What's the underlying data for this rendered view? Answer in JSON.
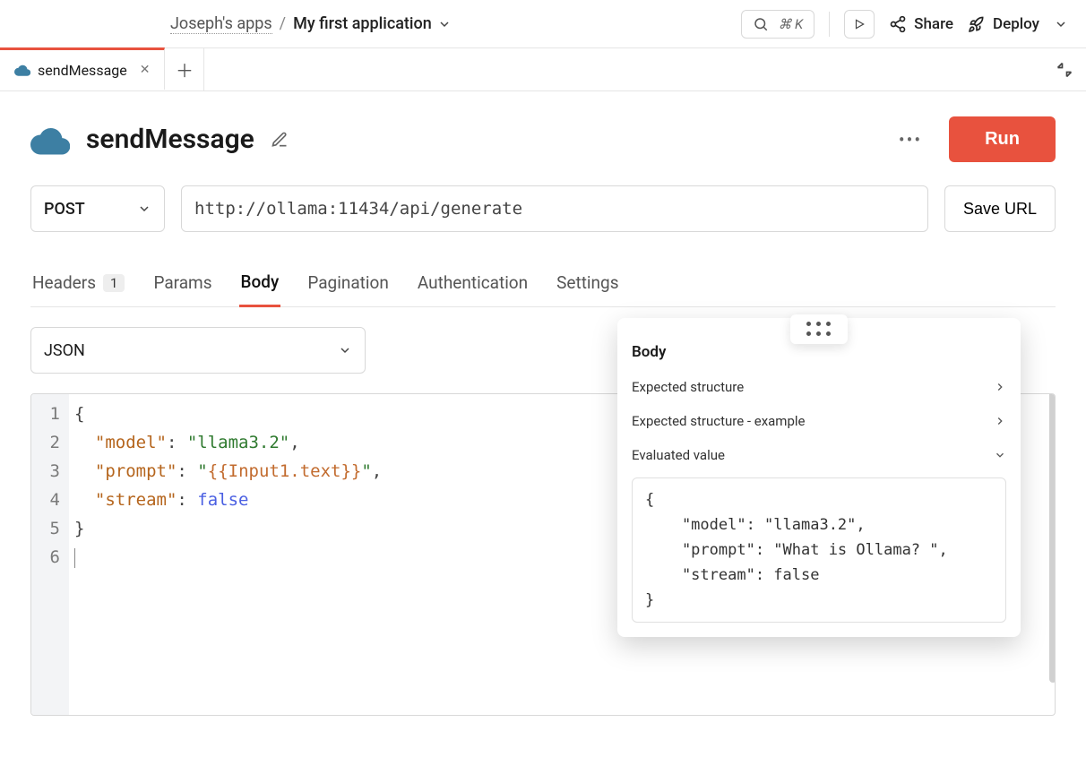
{
  "breadcrumb": {
    "owner": "Joseph's apps",
    "sep": "/",
    "app": "My first application"
  },
  "topbar": {
    "search_shortcut": "⌘ K",
    "share_label": "Share",
    "deploy_label": "Deploy"
  },
  "filetab": {
    "label": "sendMessage"
  },
  "page": {
    "title": "sendMessage",
    "run_label": "Run"
  },
  "request": {
    "method": "POST",
    "url": "http://ollama:11434/api/generate",
    "save_label": "Save URL"
  },
  "subtabs": {
    "headers": "Headers",
    "headers_count": "1",
    "params": "Params",
    "body": "Body",
    "pagination": "Pagination",
    "authentication": "Authentication",
    "settings": "Settings"
  },
  "body": {
    "format": "JSON",
    "lines": [
      "1",
      "2",
      "3",
      "4",
      "5",
      "6"
    ],
    "code": {
      "k_model": "\"model\"",
      "v_model": "\"llama3.2\"",
      "k_prompt": "\"prompt\"",
      "v_prompt_pre": "\"",
      "v_prompt_var": "{{Input1.text}}",
      "v_prompt_post": "\"",
      "k_stream": "\"stream\"",
      "v_stream": "false"
    }
  },
  "popover": {
    "title": "Body",
    "row_expected": "Expected structure",
    "row_example": "Expected structure - example",
    "row_evaluated": "Evaluated value",
    "evaluated": "{\n    \"model\": \"llama3.2\",\n    \"prompt\": \"What is Ollama? \",\n    \"stream\": false\n}"
  }
}
